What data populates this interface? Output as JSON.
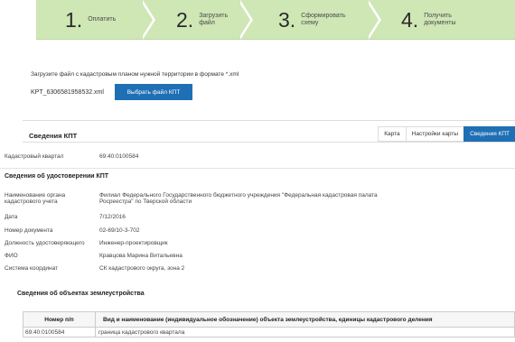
{
  "steps": [
    {
      "num": "1.",
      "label_line1": "Оплатить",
      "label_line2": ""
    },
    {
      "num": "2.",
      "label_line1": "Загрузить",
      "label_line2": "файл"
    },
    {
      "num": "3.",
      "label_line1": "Сформировать",
      "label_line2": "схему"
    },
    {
      "num": "4.",
      "label_line1": "Получить",
      "label_line2": "документы"
    }
  ],
  "upload": {
    "instruction": "Загрузите файл с кадастровым планом нужной территории в формате *.xml",
    "filename": "KPT_6306581958532.xml",
    "choose_button": "Выбрать файл КПТ"
  },
  "panel": {
    "title": "Сведения КПТ",
    "tabs": [
      "Карта",
      "Настройки карты",
      "Сведения КПТ"
    ]
  },
  "kpt": {
    "quarter_label": "Кадастровый квартал",
    "quarter_value": "69:40:0100584"
  },
  "cert": {
    "heading": "Сведения об удостоверении КПТ",
    "org_label_1": "Наименование органа",
    "org_label_2": "кадастрового учета",
    "org_value_1": "Филиал Федерального Государственного бюджетного учреждения \"Федеральная кадастровая палата",
    "org_value_2": "Росреестра\" по Тверской области",
    "date_label": "Дата",
    "date_value": "7/12/2016",
    "docnum_label": "Номер документа",
    "docnum_value": "02-69/10-3-702",
    "position_label": "Должность удостоверяющего",
    "position_value": "Инженер-проектировщик",
    "fio_label": "ФИО",
    "fio_value": "Кравцова Марина Витальевна",
    "coords_label": "Система координат",
    "coords_value": "СК кадастрового округа, зона 2"
  },
  "objects": {
    "heading": "Сведения об объектах землеустройства",
    "col1": "Номер п/п",
    "col2": "Вид и наименование (индивидуальное обозначение) объекта землеустройства, единицы кадастрового деления",
    "rows": [
      {
        "num": "69:40:0100584",
        "name": "граница кадастрового квартала"
      }
    ]
  },
  "colors": {
    "accent": "#1f6fb5",
    "steps_bg": "#cfe6b5"
  }
}
